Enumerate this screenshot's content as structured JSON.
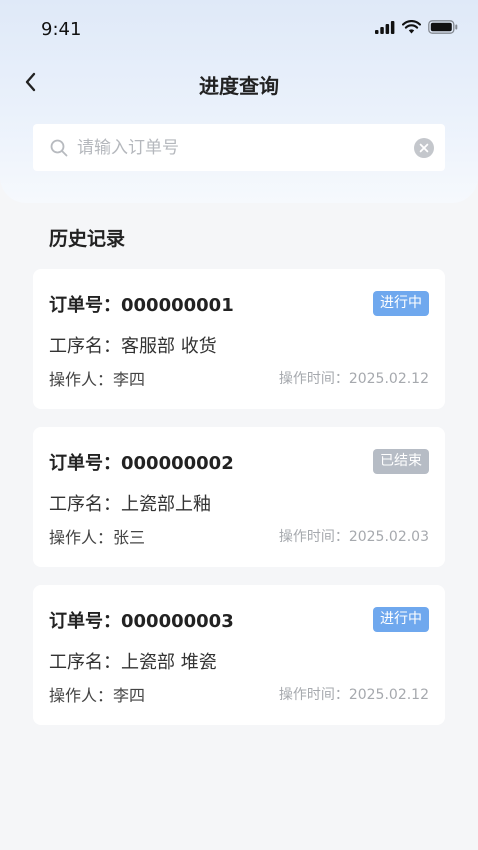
{
  "status_bar": {
    "time": "9:41"
  },
  "nav": {
    "title": "进度查询"
  },
  "search": {
    "placeholder": "请输入订单号",
    "value": ""
  },
  "history": {
    "title": "历史记录",
    "records": [
      {
        "order_label": "订单号：",
        "order_no": "000000001",
        "status": "进行中",
        "status_color": "#6fa8ee",
        "process_label": "工序名：",
        "process": "客服部 收货",
        "operator_label": "操作人：",
        "operator": "李四",
        "time_label": "操作时间：",
        "time": "2025.02.12"
      },
      {
        "order_label": "订单号：",
        "order_no": "000000002",
        "status": "已结束",
        "status_color": "#b6bcc5",
        "process_label": "工序名：",
        "process": "上瓷部上釉",
        "operator_label": "操作人：",
        "operator": "张三",
        "time_label": "操作时间：",
        "time": "2025.02.03"
      },
      {
        "order_label": "订单号：",
        "order_no": "000000003",
        "status": "进行中",
        "status_color": "#6fa8ee",
        "process_label": "工序名：",
        "process": "上瓷部 堆瓷",
        "operator_label": "操作人：",
        "operator": "李四",
        "time_label": "操作时间：",
        "time": "2025.02.12"
      }
    ]
  }
}
